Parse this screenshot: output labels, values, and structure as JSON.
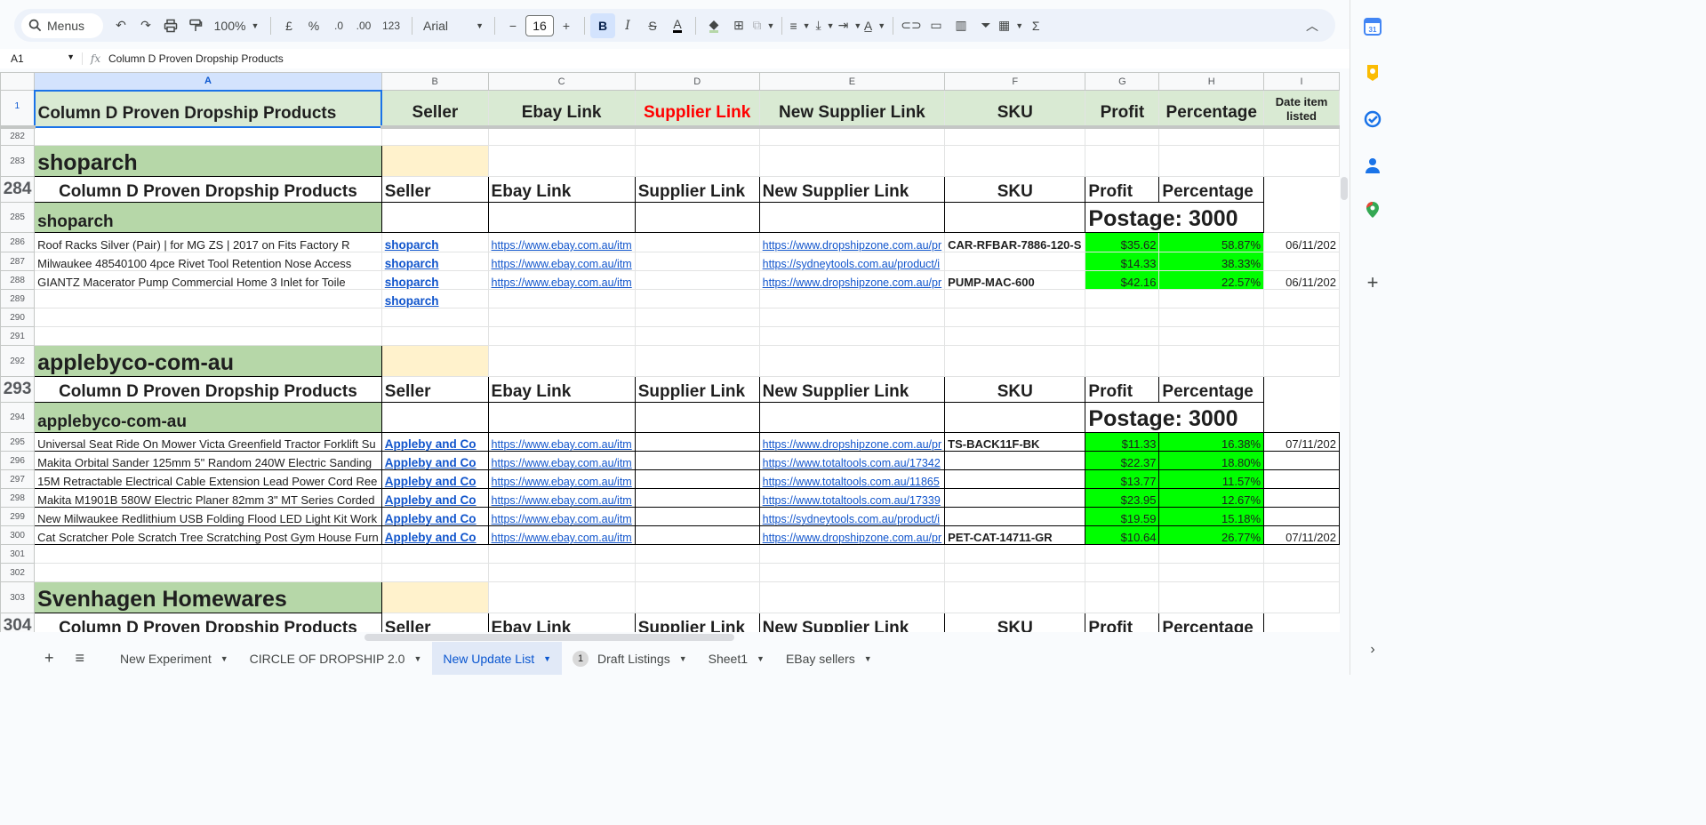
{
  "toolbar": {
    "menus_label": "Menus",
    "zoom": "100%",
    "currency": "£",
    "percent": "%",
    "decrease_decimals": ".0",
    "increase_decimals": ".00",
    "number_format": "123",
    "font": "Arial",
    "font_size": "16",
    "bold": "B",
    "italic": "I",
    "sum": "Σ"
  },
  "formula_bar": {
    "cell_ref": "A1",
    "fx": "fx",
    "content": "Column D Proven Dropship Products"
  },
  "columns": [
    "A",
    "B",
    "C",
    "D",
    "E",
    "F",
    "G",
    "H",
    "I"
  ],
  "frozen_header": {
    "row_num": "1",
    "cells": [
      "Column D Proven Dropship Products",
      "Seller",
      "Ebay Link",
      "Supplier Link",
      "New Supplier Link",
      "SKU",
      "Profit",
      "Percentage",
      "Date item listed"
    ]
  },
  "section_headers": [
    "Column D Proven Dropship Products",
    "Seller",
    "Ebay Link",
    "Supplier Link",
    "New Supplier Link",
    "SKU",
    "Profit",
    "Percentage"
  ],
  "postage_label": "Postage: 3000",
  "rows": {
    "r282": "282",
    "r283": "283",
    "shoparch_title": "shoparch",
    "r284": "284",
    "r285": "285",
    "shoparch_sub": "shoparch",
    "r286": "286",
    "r287": "287",
    "r288": "288",
    "r289": "289",
    "r290": "290",
    "r291": "291",
    "r292": "292",
    "apple_title": "applebyco-com-au",
    "r293": "293",
    "r294": "294",
    "apple_sub": "applebyco-com-au",
    "r295": "295",
    "r296": "296",
    "r297": "297",
    "r298": "298",
    "r299": "299",
    "r300": "300",
    "r301": "301",
    "r302": "302",
    "r303": "303",
    "sven_title": "Svenhagen Homewares",
    "r304": "304"
  },
  "shoparch_items": [
    {
      "product": "Roof Racks Silver (Pair) | for MG ZS | 2017 on Fits Factory R",
      "seller": "shoparch",
      "ebay": "https://www.ebay.com.au/itm",
      "supplier": "https://www.dropshipzone.com.au/pr",
      "sku": "CAR-RFBAR-7886-120-S",
      "profit": "$35.62",
      "pct": "58.87%",
      "date": "06/11/202"
    },
    {
      "product": "Milwaukee 48540100 4pce Rivet Tool Retention Nose Access",
      "seller": "shoparch",
      "ebay": "https://www.ebay.com.au/itm",
      "supplier": "https://sydneytools.com.au/product/i",
      "sku": "",
      "profit": "$14.33",
      "pct": "38.33%",
      "date": ""
    },
    {
      "product": "GIANTZ Macerator Pump Commercial Home 3 Inlet for Toile",
      "seller": "shoparch",
      "ebay": "https://www.ebay.com.au/itm",
      "supplier": "https://www.dropshipzone.com.au/pr",
      "sku": "PUMP-MAC-600",
      "profit": "$42.16",
      "pct": "22.57%",
      "date": "06/11/202"
    }
  ],
  "shoparch_extra_seller": "shoparch",
  "apple_items": [
    {
      "product": "Universal Seat Ride On Mower Victa Greenfield Tractor Forklift Su",
      "seller": "Appleby and Co",
      "ebay": "https://www.ebay.com.au/itm",
      "supplier": "https://www.dropshipzone.com.au/pr",
      "sku": "TS-BACK11F-BK",
      "profit": "$11.33",
      "pct": "16.38%",
      "date": "07/11/202"
    },
    {
      "product": "Makita Orbital Sander 125mm 5\" Random 240W Electric Sanding",
      "seller": "Appleby and Co",
      "ebay": "https://www.ebay.com.au/itm",
      "supplier": "https://www.totaltools.com.au/17342",
      "sku": "",
      "profit": "$22.37",
      "pct": "18.80%",
      "date": ""
    },
    {
      "product": "15M Retractable Electrical Cable Extension Lead Power Cord Ree",
      "seller": "Appleby and Co",
      "ebay": "https://www.ebay.com.au/itm",
      "supplier": "https://www.totaltools.com.au/11865",
      "sku": "",
      "profit": "$13.77",
      "pct": "11.57%",
      "date": ""
    },
    {
      "product": "Makita M1901B 580W Electric Planer 82mm 3\" MT Series Corded",
      "seller": "Appleby and Co",
      "ebay": "https://www.ebay.com.au/itm",
      "supplier": "https://www.totaltools.com.au/17339",
      "sku": "",
      "profit": "$23.95",
      "pct": "12.67%",
      "date": ""
    },
    {
      "product": "New Milwaukee Redlithium USB Folding Flood LED Light Kit Work",
      "seller": "Appleby and Co",
      "ebay": "https://www.ebay.com.au/itm",
      "supplier": "https://sydneytools.com.au/product/i",
      "sku": "",
      "profit": "$19.59",
      "pct": "15.18%",
      "date": ""
    },
    {
      "product": "Cat Scratcher Pole Scratch Tree Scratching Post Gym House Furn",
      "seller": "Appleby and Co",
      "ebay": "https://www.ebay.com.au/itm",
      "supplier": "https://www.dropshipzone.com.au/pr",
      "sku": "PET-CAT-14711-GR",
      "profit": "$10.64",
      "pct": "26.77%",
      "date": "07/11/202"
    }
  ],
  "sheet_tabs": {
    "add": "+",
    "all": "≡",
    "t1": "New Experiment",
    "t2": "CIRCLE OF DROPSHIP 2.0",
    "t3": "New Update List",
    "t4_badge": "1",
    "t4": "Draft Listings",
    "t5": "Sheet1",
    "t6": "EBay sellers"
  },
  "right_panel_icons": [
    "calendar-icon",
    "keep-icon",
    "tasks-icon",
    "contacts-icon",
    "maps-icon",
    "plus-icon"
  ],
  "calendar_day": "31",
  "colors": {
    "accent": "#0b57d0",
    "section_green": "#b6d7a8",
    "header_green": "#d9ead3",
    "profit_green": "#00ff00",
    "link_blue": "#1155cc",
    "peach": "#fff2cc",
    "supplier_red": "#ff0000"
  }
}
